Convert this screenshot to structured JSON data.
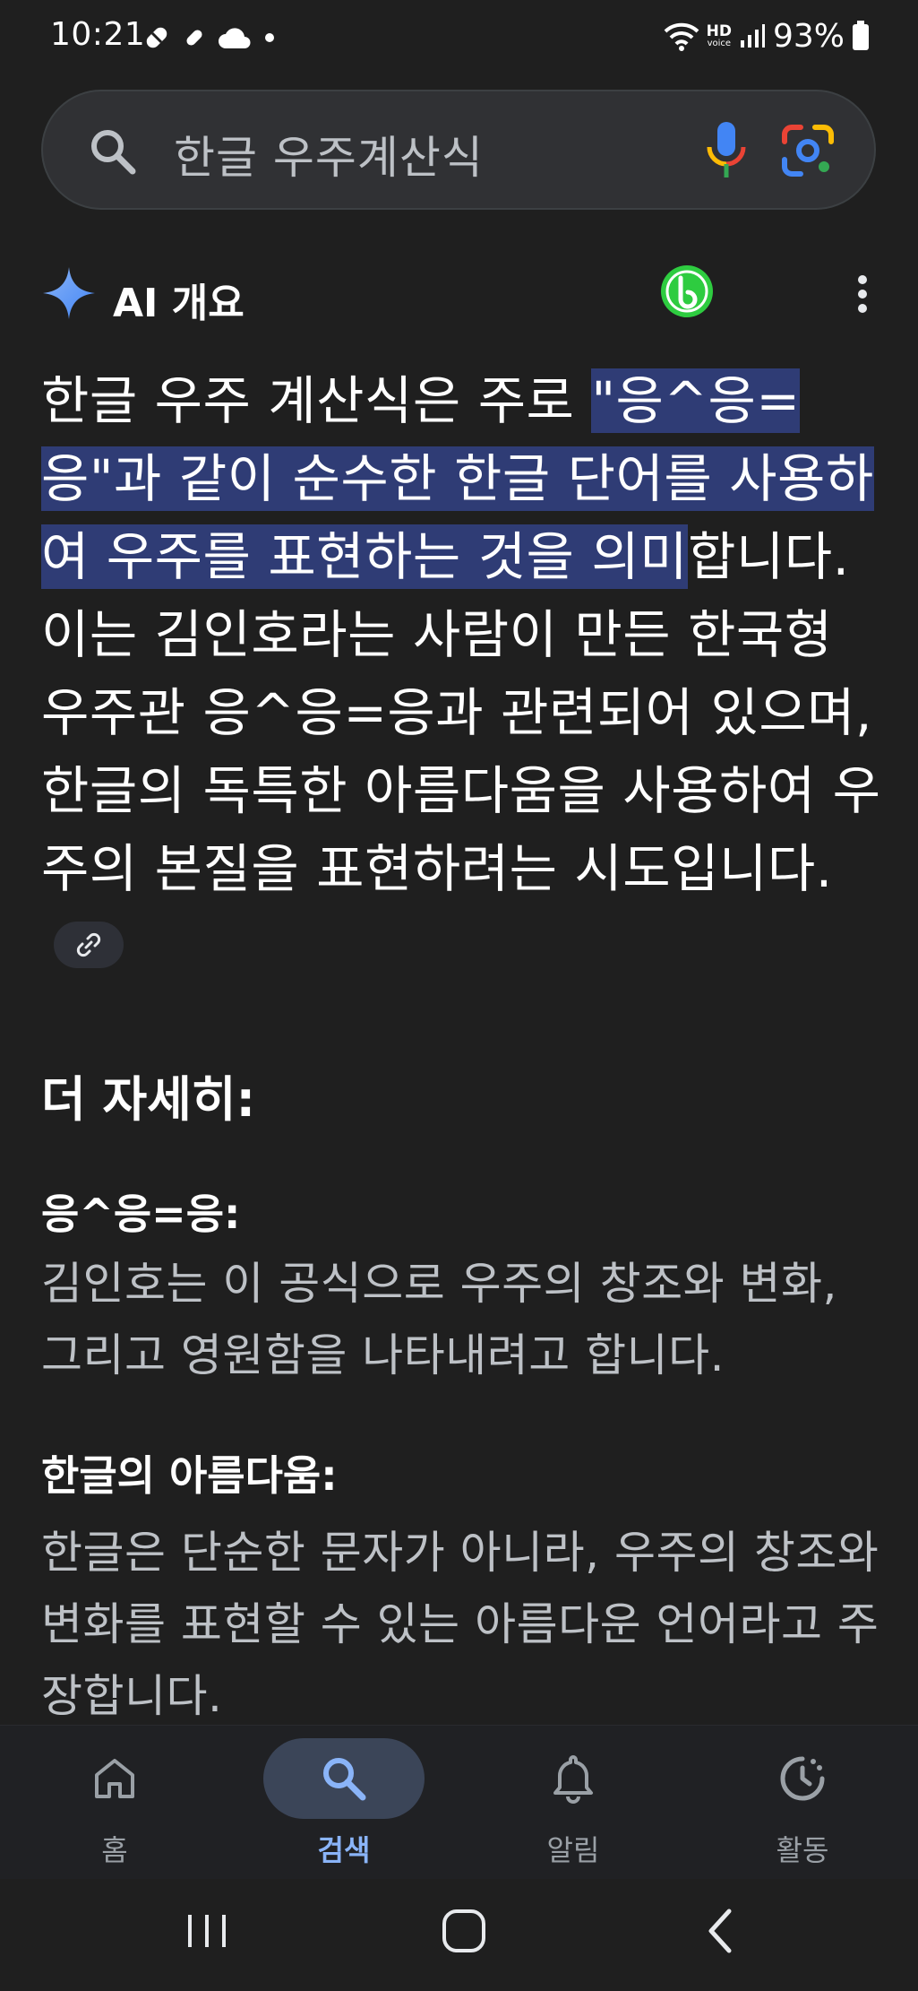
{
  "status_bar": {
    "time": "10:21",
    "battery": "93%",
    "hd_label": "HD",
    "voice_label": "voice"
  },
  "search": {
    "query": "한글 우주계산식"
  },
  "ai_overview": {
    "title": "AI 개요",
    "body_prefix": "한글 우주 계산식은 주로 ",
    "body_highlight": "\"응^응=응\"과 같이 순수한 한글 단어를 사용하여 우주를 표현하는 것을 의미",
    "body_suffix": "합니다. 이는 김인호라는 사람이 만든 한국형 우주관 응^응=응과 관련되어 있으며, 한글의 독특한 아름다움을 사용하여 우주의 본질을 표현하려는 시도입니다.",
    "more_heading": "더 자세히:",
    "sections": [
      {
        "heading": "응^응=응:",
        "text": "김인호는 이 공식으로 우주의 창조와 변화, 그리고 영원함을 나타내려고 합니다."
      },
      {
        "heading": "한글의 아름다움:",
        "text": "한글은 단순한 문자가 아니라, 우주의 창조와 변화를 표현할 수 있는 아름다운 언어라고 주장합니다."
      }
    ]
  },
  "bottom_nav": {
    "items": [
      {
        "label": "홈",
        "icon": "home-icon"
      },
      {
        "label": "검색",
        "icon": "search-icon",
        "active": true
      },
      {
        "label": "알림",
        "icon": "bell-icon"
      },
      {
        "label": "활동",
        "icon": "activity-icon"
      }
    ]
  },
  "colors": {
    "background": "#1f1f1f",
    "highlight": "#2f3c75",
    "active_nav": "#8ab4f8"
  }
}
